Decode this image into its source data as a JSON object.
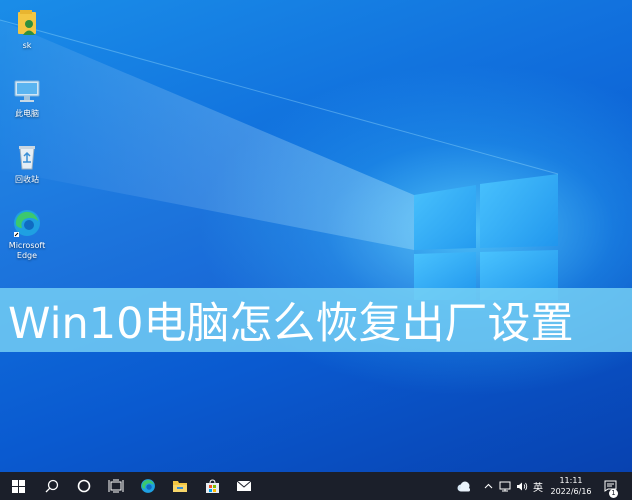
{
  "desktop": {
    "icons": [
      {
        "label": "sk",
        "icon": "user-folder-icon"
      },
      {
        "label": "此电脑",
        "icon": "this-pc-icon"
      },
      {
        "label": "回收站",
        "icon": "recycle-bin-icon"
      },
      {
        "label": "Microsoft Edge",
        "icon": "edge-icon"
      }
    ]
  },
  "banner": {
    "title": "Win10电脑怎么恢复出厂设置"
  },
  "taskbar": {
    "apps": [
      "windows-start-icon",
      "search-icon",
      "cortana-icon",
      "task-view-icon",
      "edge-icon",
      "file-explorer-icon",
      "store-icon",
      "mail-icon"
    ],
    "tray": {
      "weather_icon": "weather-cloud-icon",
      "chevron_icon": "chevron-up-icon",
      "network_icon": "network-icon",
      "volume_icon": "volume-icon",
      "ime_label": "英",
      "time": "11:11",
      "date": "2022/6/16",
      "notification_count": "1"
    }
  },
  "colors": {
    "taskbar": "#1b1f2a",
    "banner": "#78d2f5",
    "desktop_primary": "#1170dd"
  }
}
